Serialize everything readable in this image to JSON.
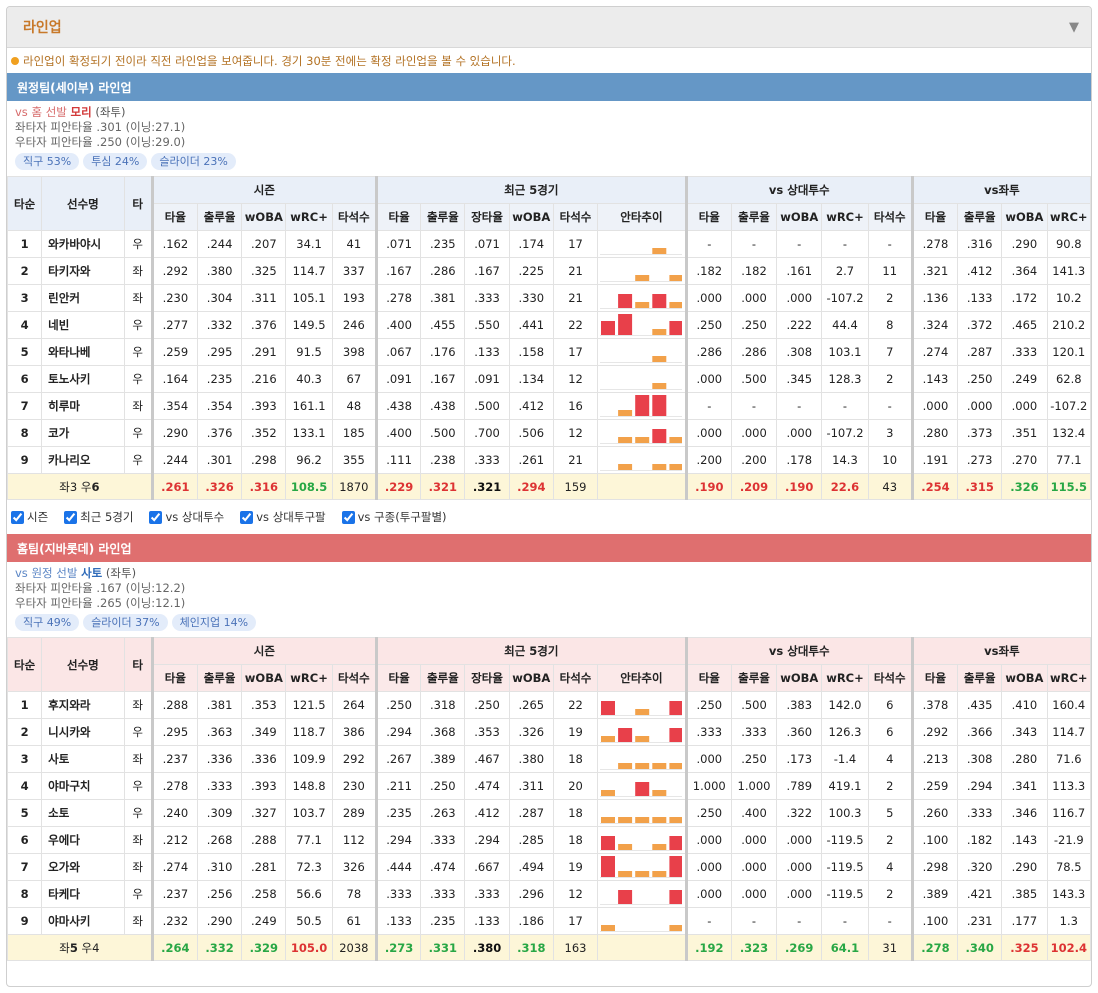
{
  "panel": {
    "title": "라인업",
    "toggle_icon": "▼"
  },
  "notice": "라인업이 확정되기 전이라 직전 라인업을 보여줍니다. 경기 30분 전에는 확정 라인업을 볼 수 있습니다.",
  "colors": {
    "away": "#6597c6",
    "home": "#df6f6f",
    "bar_high": "#e8404a",
    "bar_low": "#f2a14a"
  },
  "headers": {
    "order": "타순",
    "name": "선수명",
    "bat": "타",
    "groups": [
      "시즌",
      "최근 5경기",
      "vs 상대투수",
      "vs좌투"
    ],
    "season": [
      "타율",
      "출루율",
      "wOBA",
      "wRC+",
      "타석수"
    ],
    "recent": [
      "타율",
      "출루율",
      "장타율",
      "wOBA",
      "타석수",
      "안타추이"
    ],
    "vsp": [
      "타율",
      "출루율",
      "wOBA",
      "wRC+",
      "타석수"
    ],
    "vsl": [
      "타율",
      "출루율",
      "wOBA",
      "wRC+"
    ]
  },
  "away": {
    "title": "원정팀(세이부) 라인업",
    "pitcher": {
      "vs_label": "vs 홈 선발",
      "name": "모리",
      "hand": "좌투",
      "vs_lhb": "좌타자 피안타율 .301 (이닝:27.1)",
      "vs_rhb": "우타자 피안타율 .250 (이닝:29.0)"
    },
    "pitches": [
      "직구 53%",
      "투심 24%",
      "슬라이더 23%"
    ],
    "rows": [
      {
        "order": "1",
        "name": "와카바야시",
        "bat": "우",
        "season": [
          ".162",
          ".244",
          ".207",
          "34.1",
          "41"
        ],
        "recent": [
          ".071",
          ".235",
          ".071",
          ".174",
          "17"
        ],
        "trend": [
          0,
          0,
          0,
          1,
          0
        ],
        "vsp": [
          "-",
          "-",
          "-",
          "-",
          "-"
        ],
        "vsl": [
          ".278",
          ".316",
          ".290",
          "90.8"
        ]
      },
      {
        "order": "2",
        "name": "타키자와",
        "bat": "좌",
        "season": [
          ".292",
          ".380",
          ".325",
          "114.7",
          "337"
        ],
        "recent": [
          ".167",
          ".286",
          ".167",
          ".225",
          "21"
        ],
        "trend": [
          0,
          0,
          1,
          0,
          1
        ],
        "vsp": [
          ".182",
          ".182",
          ".161",
          "2.7",
          "11"
        ],
        "vsl": [
          ".321",
          ".412",
          ".364",
          "141.3"
        ]
      },
      {
        "order": "3",
        "name": "린안커",
        "bat": "좌",
        "season": [
          ".230",
          ".304",
          ".311",
          "105.1",
          "193"
        ],
        "recent": [
          ".278",
          ".381",
          ".333",
          ".330",
          "21"
        ],
        "trend": [
          0,
          2,
          1,
          2,
          1
        ],
        "vsp": [
          ".000",
          ".000",
          ".000",
          "-107.2",
          "2"
        ],
        "vsl": [
          ".136",
          ".133",
          ".172",
          "10.2"
        ]
      },
      {
        "order": "4",
        "name": "네빈",
        "bat": "우",
        "season": [
          ".277",
          ".332",
          ".376",
          "149.5",
          "246"
        ],
        "recent": [
          ".400",
          ".455",
          ".550",
          ".441",
          "22"
        ],
        "trend": [
          2,
          3,
          0,
          1,
          2
        ],
        "vsp": [
          ".250",
          ".250",
          ".222",
          "44.4",
          "8"
        ],
        "vsl": [
          ".324",
          ".372",
          ".465",
          "210.2"
        ]
      },
      {
        "order": "5",
        "name": "와타나베",
        "bat": "우",
        "season": [
          ".259",
          ".295",
          ".291",
          "91.5",
          "398"
        ],
        "recent": [
          ".067",
          ".176",
          ".133",
          ".158",
          "17"
        ],
        "trend": [
          0,
          0,
          0,
          1,
          0
        ],
        "vsp": [
          ".286",
          ".286",
          ".308",
          "103.1",
          "7"
        ],
        "vsl": [
          ".274",
          ".287",
          ".333",
          "120.1"
        ]
      },
      {
        "order": "6",
        "name": "토노사키",
        "bat": "우",
        "season": [
          ".164",
          ".235",
          ".216",
          "40.3",
          "67"
        ],
        "recent": [
          ".091",
          ".167",
          ".091",
          ".134",
          "12"
        ],
        "trend": [
          0,
          0,
          0,
          1,
          0
        ],
        "vsp": [
          ".000",
          ".500",
          ".345",
          "128.3",
          "2"
        ],
        "vsl": [
          ".143",
          ".250",
          ".249",
          "62.8"
        ]
      },
      {
        "order": "7",
        "name": "히루마",
        "bat": "좌",
        "season": [
          ".354",
          ".354",
          ".393",
          "161.1",
          "48"
        ],
        "recent": [
          ".438",
          ".438",
          ".500",
          ".412",
          "16"
        ],
        "trend": [
          0,
          1,
          3,
          3,
          0
        ],
        "vsp": [
          "-",
          "-",
          "-",
          "-",
          "-"
        ],
        "vsl": [
          ".000",
          ".000",
          ".000",
          "-107.2"
        ]
      },
      {
        "order": "8",
        "name": "코가",
        "bat": "우",
        "season": [
          ".290",
          ".376",
          ".352",
          "133.1",
          "185"
        ],
        "recent": [
          ".400",
          ".500",
          ".700",
          ".506",
          "12"
        ],
        "trend": [
          0,
          1,
          1,
          2,
          1
        ],
        "vsp": [
          ".000",
          ".000",
          ".000",
          "-107.2",
          "3"
        ],
        "vsl": [
          ".280",
          ".373",
          ".351",
          "132.4"
        ]
      },
      {
        "order": "9",
        "name": "카나리오",
        "bat": "우",
        "season": [
          ".244",
          ".301",
          ".298",
          "96.2",
          "355"
        ],
        "recent": [
          ".111",
          ".238",
          ".333",
          ".261",
          "21"
        ],
        "trend": [
          0,
          1,
          0,
          1,
          1
        ],
        "vsp": [
          ".200",
          ".200",
          ".178",
          "14.3",
          "10"
        ],
        "vsl": [
          ".191",
          ".273",
          ".270",
          "77.1"
        ]
      }
    ],
    "total": {
      "label_pre": "좌3 우",
      "label_bold": "6",
      "season": [
        ".261",
        ".326",
        ".316",
        "108.5",
        "1870"
      ],
      "season_cls": [
        "red",
        "red",
        "red",
        "green",
        ""
      ],
      "recent": [
        ".229",
        ".321",
        ".321",
        ".294",
        "159"
      ],
      "recent_cls": [
        "red",
        "red",
        "bk",
        "red",
        ""
      ],
      "vsp": [
        ".190",
        ".209",
        ".190",
        "22.6",
        "43"
      ],
      "vsp_cls": [
        "red",
        "red",
        "red",
        "red",
        ""
      ],
      "vsl": [
        ".254",
        ".315",
        ".326",
        "115.5"
      ],
      "vsl_cls": [
        "red",
        "red",
        "green",
        "green"
      ]
    }
  },
  "checks": [
    "시즌",
    "최근 5경기",
    "vs 상대투수",
    "vs 상대투구팔",
    "vs 구종(투구팔별)"
  ],
  "home": {
    "title": "홈팀(지바롯데) 라인업",
    "pitcher": {
      "vs_label": "vs 원정 선발",
      "name": "사토",
      "hand": "좌투",
      "vs_lhb": "좌타자 피안타율 .167 (이닝:12.2)",
      "vs_rhb": "우타자 피안타율 .265 (이닝:12.1)"
    },
    "pitches": [
      "직구 49%",
      "슬라이더 37%",
      "체인지업 14%"
    ],
    "rows": [
      {
        "order": "1",
        "name": "후지와라",
        "bat": "좌",
        "season": [
          ".288",
          ".381",
          ".353",
          "121.5",
          "264"
        ],
        "recent": [
          ".250",
          ".318",
          ".250",
          ".265",
          "22"
        ],
        "trend": [
          2,
          0,
          1,
          0,
          2
        ],
        "vsp": [
          ".250",
          ".500",
          ".383",
          "142.0",
          "6"
        ],
        "vsl": [
          ".378",
          ".435",
          ".410",
          "160.4"
        ]
      },
      {
        "order": "2",
        "name": "니시카와",
        "bat": "우",
        "season": [
          ".295",
          ".363",
          ".349",
          "118.7",
          "386"
        ],
        "recent": [
          ".294",
          ".368",
          ".353",
          ".326",
          "19"
        ],
        "trend": [
          1,
          2,
          1,
          0,
          2
        ],
        "vsp": [
          ".333",
          ".333",
          ".360",
          "126.3",
          "6"
        ],
        "vsl": [
          ".292",
          ".366",
          ".343",
          "114.7"
        ]
      },
      {
        "order": "3",
        "name": "사토",
        "bat": "좌",
        "season": [
          ".237",
          ".336",
          ".336",
          "109.9",
          "292"
        ],
        "recent": [
          ".267",
          ".389",
          ".467",
          ".380",
          "18"
        ],
        "trend": [
          0,
          1,
          1,
          1,
          1
        ],
        "vsp": [
          ".000",
          ".250",
          ".173",
          "-1.4",
          "4"
        ],
        "vsl": [
          ".213",
          ".308",
          ".280",
          "71.6"
        ]
      },
      {
        "order": "4",
        "name": "야마구치",
        "bat": "우",
        "season": [
          ".278",
          ".333",
          ".393",
          "148.8",
          "230"
        ],
        "recent": [
          ".211",
          ".250",
          ".474",
          ".311",
          "20"
        ],
        "trend": [
          1,
          0,
          2,
          1,
          0
        ],
        "vsp": [
          "1.000",
          "1.000",
          ".789",
          "419.1",
          "2"
        ],
        "vsl": [
          ".259",
          ".294",
          ".341",
          "113.3"
        ]
      },
      {
        "order": "5",
        "name": "소토",
        "bat": "우",
        "season": [
          ".240",
          ".309",
          ".327",
          "103.7",
          "289"
        ],
        "recent": [
          ".235",
          ".263",
          ".412",
          ".287",
          "18"
        ],
        "trend": [
          1,
          1,
          1,
          1,
          1
        ],
        "vsp": [
          ".250",
          ".400",
          ".322",
          "100.3",
          "5"
        ],
        "vsl": [
          ".260",
          ".333",
          ".346",
          "116.7"
        ]
      },
      {
        "order": "6",
        "name": "우에다",
        "bat": "좌",
        "season": [
          ".212",
          ".268",
          ".288",
          "77.1",
          "112"
        ],
        "recent": [
          ".294",
          ".333",
          ".294",
          ".285",
          "18"
        ],
        "trend": [
          2,
          1,
          0,
          1,
          2
        ],
        "vsp": [
          ".000",
          ".000",
          ".000",
          "-119.5",
          "2"
        ],
        "vsl": [
          ".100",
          ".182",
          ".143",
          "-21.9"
        ]
      },
      {
        "order": "7",
        "name": "오가와",
        "bat": "좌",
        "season": [
          ".274",
          ".310",
          ".281",
          "72.3",
          "326"
        ],
        "recent": [
          ".444",
          ".474",
          ".667",
          ".494",
          "19"
        ],
        "trend": [
          3,
          1,
          1,
          1,
          3
        ],
        "vsp": [
          ".000",
          ".000",
          ".000",
          "-119.5",
          "4"
        ],
        "vsl": [
          ".298",
          ".320",
          ".290",
          "78.5"
        ]
      },
      {
        "order": "8",
        "name": "타케다",
        "bat": "우",
        "season": [
          ".237",
          ".256",
          ".258",
          "56.6",
          "78"
        ],
        "recent": [
          ".333",
          ".333",
          ".333",
          ".296",
          "12"
        ],
        "trend": [
          0,
          2,
          0,
          0,
          2
        ],
        "vsp": [
          ".000",
          ".000",
          ".000",
          "-119.5",
          "2"
        ],
        "vsl": [
          ".389",
          ".421",
          ".385",
          "143.3"
        ]
      },
      {
        "order": "9",
        "name": "야마사키",
        "bat": "좌",
        "season": [
          ".232",
          ".290",
          ".249",
          "50.5",
          "61"
        ],
        "recent": [
          ".133",
          ".235",
          ".133",
          ".186",
          "17"
        ],
        "trend": [
          1,
          0,
          0,
          0,
          1
        ],
        "vsp": [
          "-",
          "-",
          "-",
          "-",
          "-"
        ],
        "vsl": [
          ".100",
          ".231",
          ".177",
          "1.3"
        ]
      }
    ],
    "total": {
      "label_pre": "좌",
      "label_bold": "5",
      "label_post": " 우4",
      "season": [
        ".264",
        ".332",
        ".329",
        "105.0",
        "2038"
      ],
      "season_cls": [
        "green",
        "green",
        "green",
        "red",
        ""
      ],
      "recent": [
        ".273",
        ".331",
        ".380",
        ".318",
        "163"
      ],
      "recent_cls": [
        "green",
        "green",
        "bk",
        "green",
        ""
      ],
      "vsp": [
        ".192",
        ".323",
        ".269",
        "64.1",
        "31"
      ],
      "vsp_cls": [
        "green",
        "green",
        "green",
        "green",
        ""
      ],
      "vsl": [
        ".278",
        ".340",
        ".325",
        "102.4"
      ],
      "vsl_cls": [
        "green",
        "green",
        "red",
        "red"
      ]
    }
  }
}
